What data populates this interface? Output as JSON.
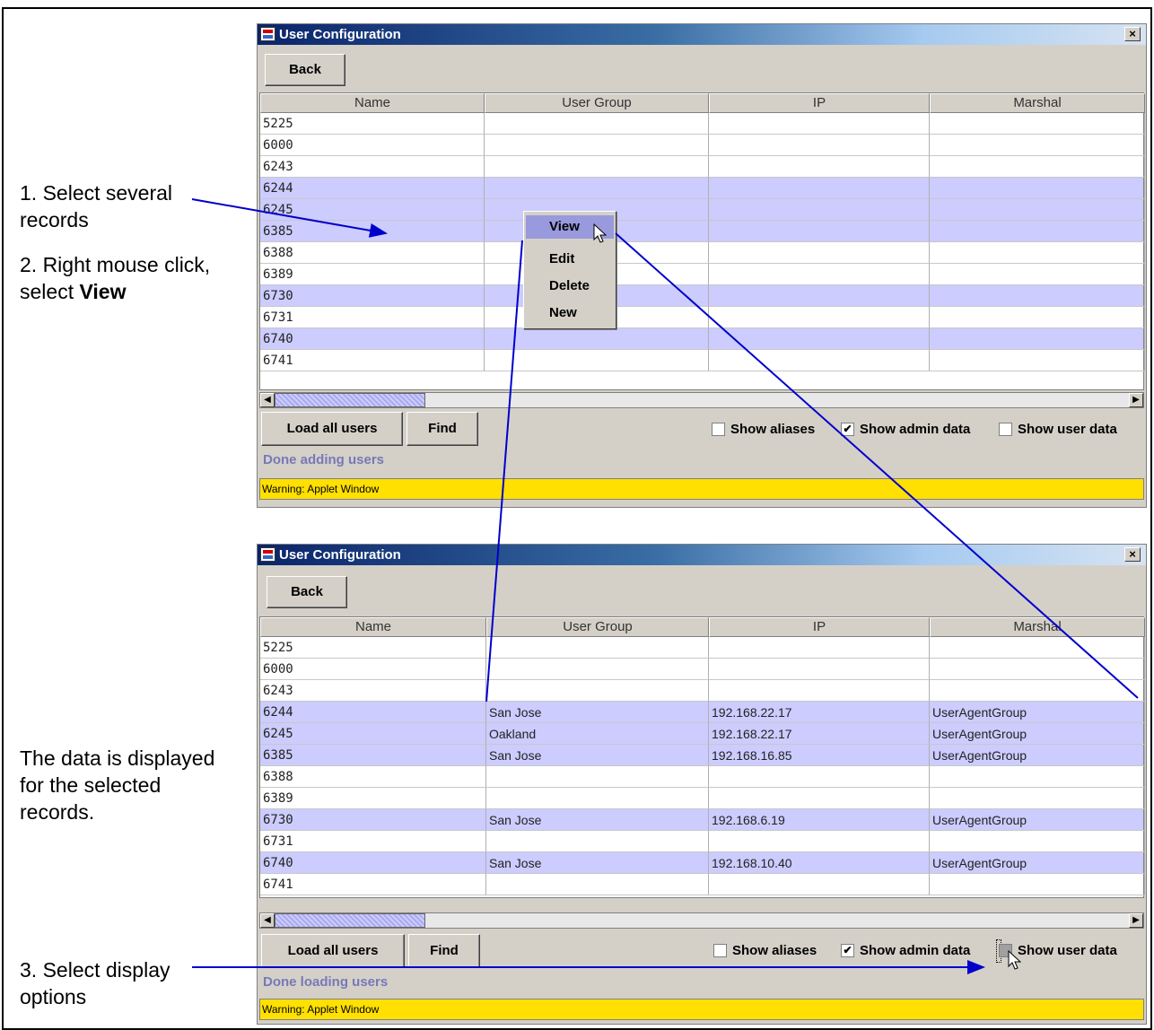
{
  "annotations": {
    "step1": "1. Select several records",
    "step2_prefix": "2. Right mouse click, select ",
    "step2_bold": "View",
    "result": "The data is displayed for the selected records.",
    "step3": "3. Select display options"
  },
  "window_top": {
    "title": "User Configuration",
    "close_label": "×",
    "back_label": "Back",
    "columns": [
      "Name",
      "User Group",
      "IP",
      "Marshal"
    ],
    "rows": [
      {
        "name": "5225",
        "group": "",
        "ip": "",
        "marshal": "",
        "selected": false
      },
      {
        "name": "6000",
        "group": "",
        "ip": "",
        "marshal": "",
        "selected": false
      },
      {
        "name": "6243",
        "group": "",
        "ip": "",
        "marshal": "",
        "selected": false
      },
      {
        "name": "6244",
        "group": "",
        "ip": "",
        "marshal": "",
        "selected": true
      },
      {
        "name": "6245",
        "group": "",
        "ip": "",
        "marshal": "",
        "selected": true
      },
      {
        "name": "6385",
        "group": "",
        "ip": "",
        "marshal": "",
        "selected": true
      },
      {
        "name": "6388",
        "group": "",
        "ip": "",
        "marshal": "",
        "selected": false
      },
      {
        "name": "6389",
        "group": "",
        "ip": "",
        "marshal": "",
        "selected": false
      },
      {
        "name": "6730",
        "group": "",
        "ip": "",
        "marshal": "",
        "selected": true
      },
      {
        "name": "6731",
        "group": "",
        "ip": "",
        "marshal": "",
        "selected": false
      },
      {
        "name": "6740",
        "group": "",
        "ip": "",
        "marshal": "",
        "selected": true
      },
      {
        "name": "6741",
        "group": "",
        "ip": "",
        "marshal": "",
        "selected": false
      }
    ],
    "load_all_label": "Load all users",
    "find_label": "Find",
    "show_aliases": {
      "label": "Show aliases",
      "checked": false
    },
    "show_admin": {
      "label": "Show admin data",
      "checked": true
    },
    "show_user": {
      "label": "Show user data",
      "checked": false
    },
    "status": "Done adding users",
    "warning": "Warning: Applet Window",
    "context_menu": {
      "items": [
        "View",
        "Edit",
        "Delete",
        "New"
      ],
      "highlighted": "View"
    }
  },
  "window_bottom": {
    "title": "User Configuration",
    "close_label": "×",
    "back_label": "Back",
    "columns": [
      "Name",
      "User Group",
      "IP",
      "Marshal"
    ],
    "rows": [
      {
        "name": "5225",
        "group": "",
        "ip": "",
        "marshal": "",
        "selected": false
      },
      {
        "name": "6000",
        "group": "",
        "ip": "",
        "marshal": "",
        "selected": false
      },
      {
        "name": "6243",
        "group": "",
        "ip": "",
        "marshal": "",
        "selected": false
      },
      {
        "name": "6244",
        "group": "San Jose",
        "ip": "192.168.22.17",
        "marshal": "UserAgentGroup",
        "selected": true
      },
      {
        "name": "6245",
        "group": "Oakland",
        "ip": "192.168.22.17",
        "marshal": "UserAgentGroup",
        "selected": true
      },
      {
        "name": "6385",
        "group": "San Jose",
        "ip": "192.168.16.85",
        "marshal": "UserAgentGroup",
        "selected": true
      },
      {
        "name": "6388",
        "group": "",
        "ip": "",
        "marshal": "",
        "selected": false
      },
      {
        "name": "6389",
        "group": "",
        "ip": "",
        "marshal": "",
        "selected": false
      },
      {
        "name": "6730",
        "group": "San Jose",
        "ip": "192.168.6.19",
        "marshal": "UserAgentGroup",
        "selected": true
      },
      {
        "name": "6731",
        "group": "",
        "ip": "",
        "marshal": "",
        "selected": false
      },
      {
        "name": "6740",
        "group": "San Jose",
        "ip": "192.168.10.40",
        "marshal": "UserAgentGroup",
        "selected": true
      },
      {
        "name": "6741",
        "group": "",
        "ip": "",
        "marshal": "",
        "selected": false
      }
    ],
    "load_all_label": "Load all users",
    "find_label": "Find",
    "show_aliases": {
      "label": "Show aliases",
      "checked": false
    },
    "show_admin": {
      "label": "Show admin data",
      "checked": true
    },
    "show_user": {
      "label": "Show user data",
      "checked": false
    },
    "status": "Done loading users",
    "warning": "Warning: Applet Window"
  },
  "colors": {
    "selected_row": "#ccccff",
    "warning_bar": "#ffe000",
    "arrow": "#0000cc",
    "menu_highlight": "#9999dd"
  }
}
